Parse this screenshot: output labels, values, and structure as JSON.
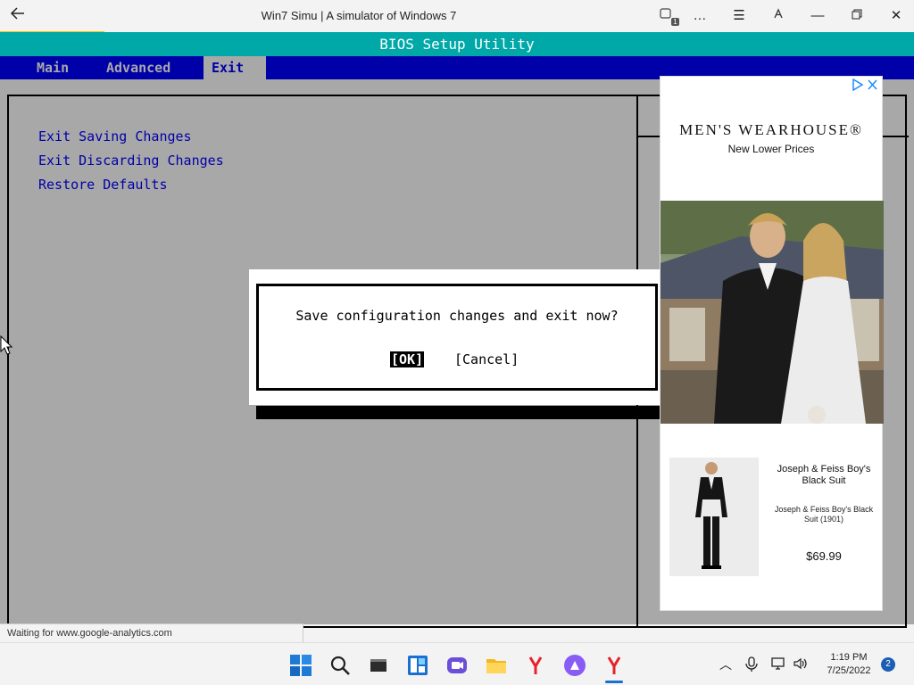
{
  "browser": {
    "title": "Win7 Simu | A simulator of Windows 7",
    "tab_count": "1",
    "loading_progress": 0.114
  },
  "bios": {
    "header": "BIOS Setup Utility",
    "tabs": [
      {
        "label": "Main"
      },
      {
        "label": "Advanced"
      },
      {
        "label": "Exit",
        "active": true
      }
    ],
    "options": [
      {
        "label": "Exit Saving Changes"
      },
      {
        "label": "Exit Discarding Changes"
      },
      {
        "label": "Restore Defaults"
      }
    ],
    "dialog": {
      "message": "Save configuration changes and exit now?",
      "ok_label": "[OK]",
      "cancel_label": "[Cancel]"
    },
    "colors": {
      "background": "#a8a8a8",
      "menubar": "#0000a8",
      "header": "#00a8a8"
    }
  },
  "ad": {
    "brand": "MEN'S WEARHOUSE®",
    "tagline": "New Lower Prices",
    "product_title": "Joseph & Feiss Boy's Black Suit",
    "product_subtitle": "Joseph & Feiss Boy's Black Suit (1901)",
    "price": "$69.99"
  },
  "statusbar": {
    "text": "Waiting for www.google-analytics.com"
  },
  "taskbar": {
    "time": "1:19 PM",
    "date": "7/25/2022",
    "notification_count": "2",
    "icons": [
      "windows-start-icon",
      "search-icon",
      "terminal-icon",
      "widgets-icon",
      "chat-icon",
      "file-explorer-icon",
      "yandex-icon",
      "alice-icon",
      "yandex-browser-icon"
    ]
  }
}
